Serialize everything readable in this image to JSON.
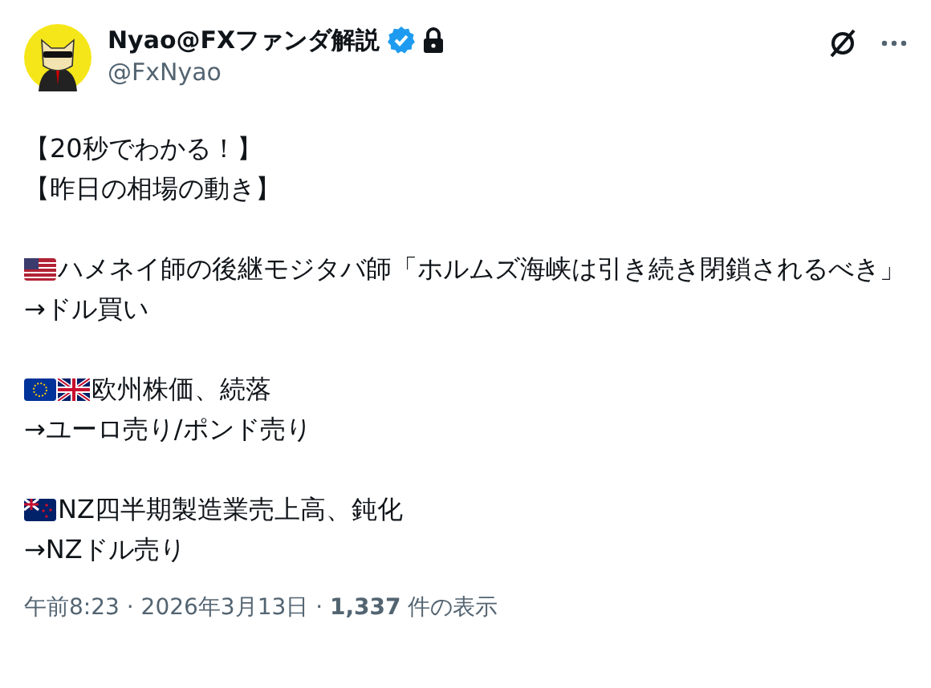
{
  "author": {
    "name": "Nyao@FXファンダ解説",
    "handle": "@FxNyao",
    "verified": true,
    "protected": true
  },
  "paragraphs": [
    [
      {
        "text": "【20秒でわかる！】"
      },
      {
        "text": "【昨日の相場の動き】"
      }
    ],
    [
      {
        "text": "ハメネイ師の後継モジタバ師「ホルムズ海峡は引き続き閉鎖されるべき」",
        "flags": [
          {
            "kind": "us"
          }
        ]
      },
      {
        "text": "→ドル買い"
      }
    ],
    [
      {
        "text": "欧州株価、続落",
        "flags": [
          {
            "kind": "eu"
          },
          {
            "kind": "gb"
          }
        ]
      },
      {
        "text": "→ユーロ売り/ポンド売り"
      }
    ],
    [
      {
        "text": "NZ四半期製造業売上高、鈍化",
        "flags": [
          {
            "kind": "nz"
          }
        ]
      },
      {
        "text": "→NZドル売り"
      }
    ]
  ],
  "footer": "午前8:23 · 2026年3月13日 · **1,337** 件の表示"
}
